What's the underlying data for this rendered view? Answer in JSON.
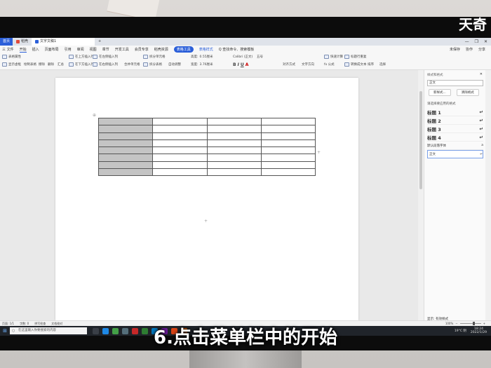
{
  "watermark": "天奇",
  "subtitle": "6.点击菜单栏中的开始",
  "tabs": {
    "home": "首页",
    "shell": "稻壳",
    "document": "文字文稿1",
    "new_tab": "+"
  },
  "menu": {
    "file": "三 文件",
    "items": [
      "开始",
      "插入",
      "页面布局",
      "引用",
      "审阅",
      "视图",
      "章节",
      "开发工具",
      "会员专享",
      "稻壳资源"
    ],
    "table_tools": "表格工具",
    "table_style": "表格样式",
    "search": "Q 查找命令、搜索模板",
    "right": [
      "未保存",
      "协作",
      "分享"
    ]
  },
  "ribbon": {
    "table_props": "表格属性",
    "show_gridlines": "显示虚框",
    "draw_table": "绘制表格",
    "erase": "擦除",
    "delete": "删除",
    "summary": "汇总",
    "insert_above": "在上方插入行",
    "insert_below": "在下方插入行",
    "insert_left": "在左侧插入列",
    "insert_right": "在右侧插入列",
    "merge_cells": "合并单元格",
    "split_cells": "拆分单元格",
    "split_table": "拆分表格",
    "auto_fit": "自动调整",
    "height": "高度:",
    "height_val": "0.55厘米",
    "width": "宽度:",
    "width_val": "3.76厘米",
    "font": "Calibri (正文)",
    "size": "五号",
    "align": "对齐方式",
    "text_dir": "文字方向",
    "calc": "快速计算",
    "repeat_header": "标题行重复",
    "formula": "fx 公式",
    "to_text": "转换成文本",
    "sort": "排序",
    "select": "选择"
  },
  "panel": {
    "title": "样式和格式",
    "current": "正文",
    "new_style": "新样式...",
    "clear_format": "清除格式",
    "apply_label": "请选择要应用的格式",
    "styles": [
      "标题 1",
      "标题 2",
      "标题 3",
      "标题 4"
    ],
    "default_font": "默认段落字体",
    "body": "正文",
    "show_label": "显示:",
    "show_value": "有效样式",
    "preview": "显示预览"
  },
  "statusbar": {
    "page": "页面: 1/1",
    "words": "字数: 0",
    "spell": "拼写检查",
    "doc_check": "文档校对",
    "zoom": "100%"
  },
  "taskbar": {
    "search_placeholder": "在这里输入你要搜索的内容",
    "weather": "19°C 阴",
    "time": "18:24",
    "date": "2022/1/29"
  },
  "table": {
    "rows": 8,
    "cols": 4
  },
  "colors": {
    "accent": "#2b5fd9",
    "shaded_cell": "#c4c4c4",
    "taskbar": "#20242a"
  }
}
